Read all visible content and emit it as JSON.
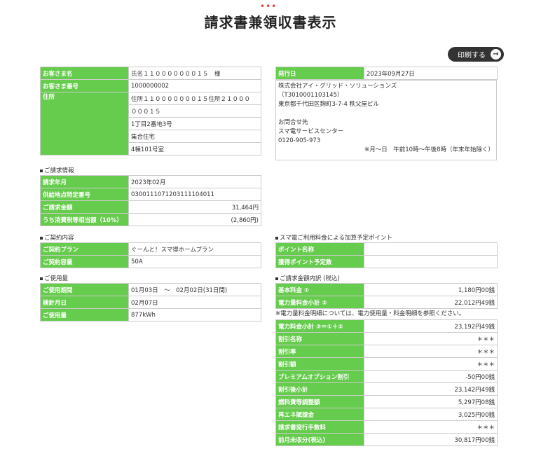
{
  "title": "請求書兼領収書表示",
  "print_button": "印刷する",
  "customer": {
    "name_label": "お客さま名",
    "name": "氏名１１０００００００１５　様",
    "number_label": "お客さま番号",
    "number": "1000000002",
    "address_label": "住所",
    "address_lines": [
      "住所１１０００００００１５住所２１０００",
      "０００１５",
      "1丁目2番地3号",
      "集合住宅",
      "4棟101号室"
    ]
  },
  "issuer": {
    "issue_date_label": "発行日",
    "issue_date": "2023年09月27日",
    "company": "株式会社アイ・グリッド・ソリューションズ",
    "reg_no": "（T3010001103145）",
    "address": "東京都千代田区麹町3-7-4 秩父屋ビル",
    "contact_label": "お問合せ先",
    "contact_name": "スマ電サービスセンター",
    "phone": "0120-905-973",
    "hours": "※月～日　午前10時～午後8時（年末年始除く）"
  },
  "billing": {
    "heading": "ご請求情報",
    "rows": [
      {
        "label": "請求年月",
        "value": "2023年02月"
      },
      {
        "label": "供給地点特定番号",
        "value": "0300111071203111104011"
      },
      {
        "label": "ご請求金額",
        "value": "31,464円"
      },
      {
        "label": "うち消費税等相当額（10%）",
        "value": "(2,860円)"
      }
    ]
  },
  "contract": {
    "heading": "ご契約内容",
    "rows": [
      {
        "label": "ご契約プラン",
        "value": "ぐーんと！スマ得ホームプラン"
      },
      {
        "label": "ご契約容量",
        "value": "50A"
      }
    ]
  },
  "usage": {
    "heading": "ご使用量",
    "rows": [
      {
        "label": "ご使用期間",
        "value": "01月03日　～　02月02日(31日間)"
      },
      {
        "label": "検針月日",
        "value": "02月07日"
      },
      {
        "label": "ご使用量",
        "value": "877kWh"
      }
    ]
  },
  "points": {
    "heading": "スマ電ご利用料金による加算予定ポイント",
    "rows": [
      {
        "label": "ポイント名称",
        "value": ""
      },
      {
        "label": "獲得ポイント予定数",
        "value": ""
      }
    ]
  },
  "breakdown": {
    "heading": "ご請求金額内訳 (税込)",
    "rows_a": [
      {
        "label": "基本料金 ①",
        "value": "1,180円00銭"
      },
      {
        "label": "電力量料金小計 ②",
        "value": "22,012円49銭"
      }
    ],
    "note": "※電力量料金明細については、電力使用量・料金明細を参照ください。",
    "rows_b": [
      {
        "label": "電力料金小計 ③＝①＋②",
        "value": "23,192円49銭"
      },
      {
        "label": "割引名称",
        "value": "＊＊＊"
      },
      {
        "label": "割引率",
        "value": "＊＊＊"
      },
      {
        "label": "割引額",
        "value": "＊＊＊"
      },
      {
        "label": "プレミアムオプション割引",
        "value": "-50円00銭"
      },
      {
        "label": "割引後小計",
        "value": "23,142円49銭"
      },
      {
        "label": "燃料費等調整額",
        "value": "5,297円08銭"
      },
      {
        "label": "再エネ賦課金",
        "value": "3,025円00銭"
      },
      {
        "label": "請求書発行手数料",
        "value": "＊＊＊"
      },
      {
        "label": "前月未収分(税込)",
        "value": "30,817円00銭"
      }
    ]
  }
}
